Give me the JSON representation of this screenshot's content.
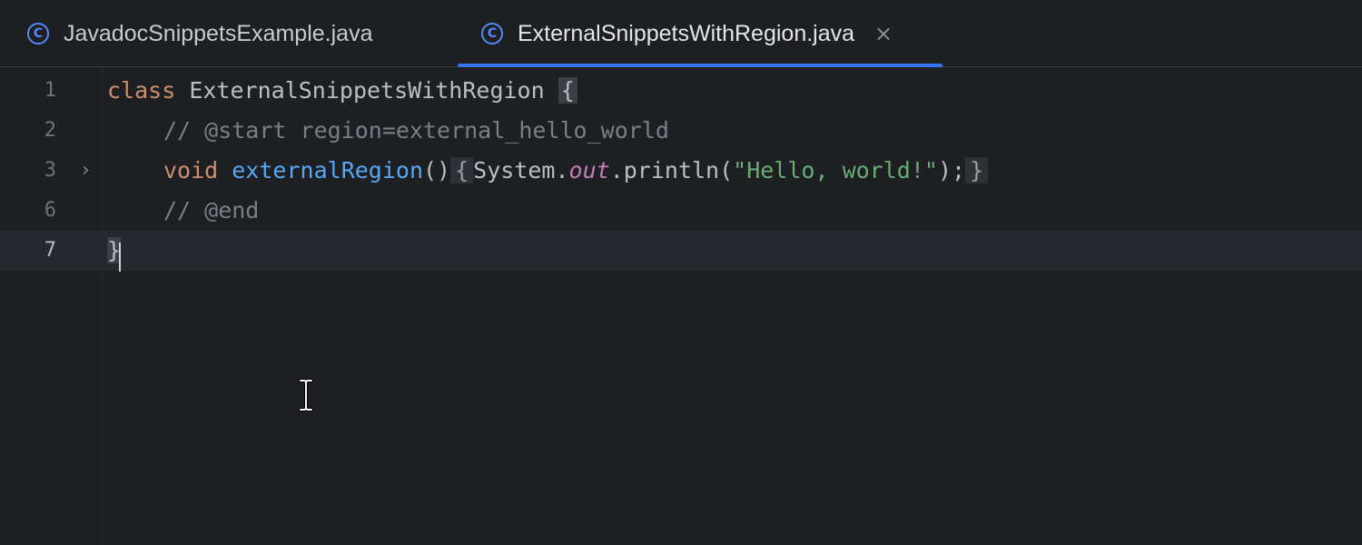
{
  "tabs": [
    {
      "label": "JavadocSnippetsExample.java",
      "icon": "java-class-icon",
      "active": false
    },
    {
      "label": "ExternalSnippetsWithRegion.java",
      "icon": "java-class-icon",
      "active": true,
      "close_icon": "close-icon"
    }
  ],
  "icon_glyph": "C",
  "close_glyph": "×",
  "fold_glyph": "›",
  "colors": {
    "background": "#1e1f22",
    "current_line": "#26282e",
    "tab_underline": "#3574f0",
    "keyword": "#cf8e6d",
    "method": "#56a8f5",
    "comment": "#7a7e85",
    "static_field": "#c77dbb",
    "string": "#6aab73"
  },
  "editor": {
    "lines": [
      {
        "number": "1",
        "keyword": "class",
        "class_name": "ExternalSnippetsWithRegion",
        "brace": "{"
      },
      {
        "number": "2",
        "comment": "// @start region=external_hello_world"
      },
      {
        "number": "3",
        "keyword": "void",
        "method_name": "externalRegion",
        "parens": "()",
        "fold_open": "{",
        "receiver": "System.",
        "static_field": "out",
        "call": ".println(",
        "string_literal": "\"Hello, world!\"",
        "call_end": ");",
        "fold_close": "}"
      },
      {
        "number": "6",
        "comment": "// @end"
      },
      {
        "number": "7",
        "brace": "}"
      }
    ]
  }
}
